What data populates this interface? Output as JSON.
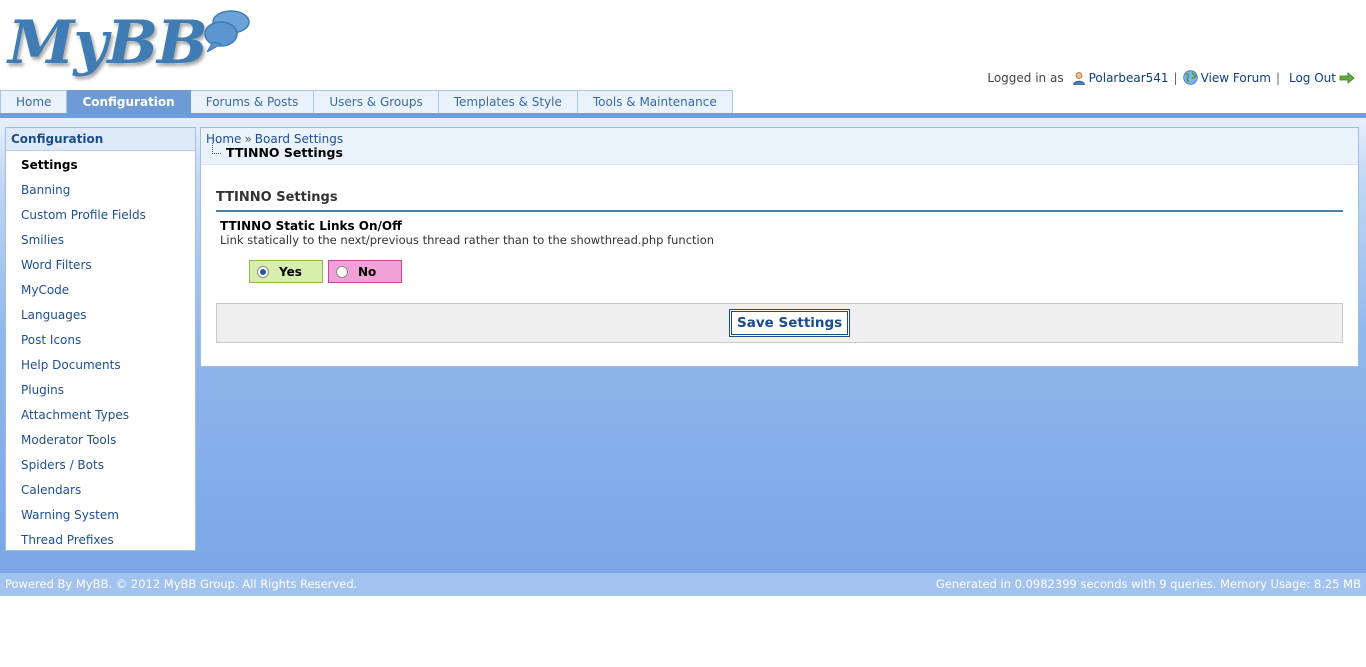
{
  "header": {
    "logo_text": "MyBB",
    "logged_in_label": "Logged in as",
    "username": "Polarbear541",
    "view_forum": "View Forum",
    "logout": "Log Out",
    "separator": "|"
  },
  "menu": {
    "tabs": [
      {
        "label": "Home"
      },
      {
        "label": "Configuration"
      },
      {
        "label": "Forums & Posts"
      },
      {
        "label": "Users & Groups"
      },
      {
        "label": "Templates & Style"
      },
      {
        "label": "Tools & Maintenance"
      }
    ]
  },
  "sidebar": {
    "title": "Configuration",
    "items": [
      {
        "label": "Settings"
      },
      {
        "label": "Banning"
      },
      {
        "label": "Custom Profile Fields"
      },
      {
        "label": "Smilies"
      },
      {
        "label": "Word Filters"
      },
      {
        "label": "MyCode"
      },
      {
        "label": "Languages"
      },
      {
        "label": "Post Icons"
      },
      {
        "label": "Help Documents"
      },
      {
        "label": "Plugins"
      },
      {
        "label": "Attachment Types"
      },
      {
        "label": "Moderator Tools"
      },
      {
        "label": "Spiders / Bots"
      },
      {
        "label": "Calendars"
      },
      {
        "label": "Warning System"
      },
      {
        "label": "Thread Prefixes"
      }
    ]
  },
  "breadcrumb": {
    "home": "Home",
    "separator": "»",
    "parent": "Board Settings",
    "current": "TTINNO Settings"
  },
  "content": {
    "section_title": "TTINNO Settings",
    "setting": {
      "name": "TTINNO Static Links On/Off",
      "description": "Link statically to the next/previous thread rather than to the showthread.php function",
      "yes_label": "Yes",
      "no_label": "No",
      "selected": "Yes"
    },
    "save_label": "Save Settings"
  },
  "footer": {
    "left": "Powered By MyBB. © 2012 MyBB Group. All Rights Reserved.",
    "right": "Generated in 0.0982399 seconds with 9 queries. Memory Usage: 8.25 MB"
  },
  "colors": {
    "accent": "#6e9bd6",
    "yes_bg": "#d6efac",
    "no_bg": "#f0a2d8"
  }
}
